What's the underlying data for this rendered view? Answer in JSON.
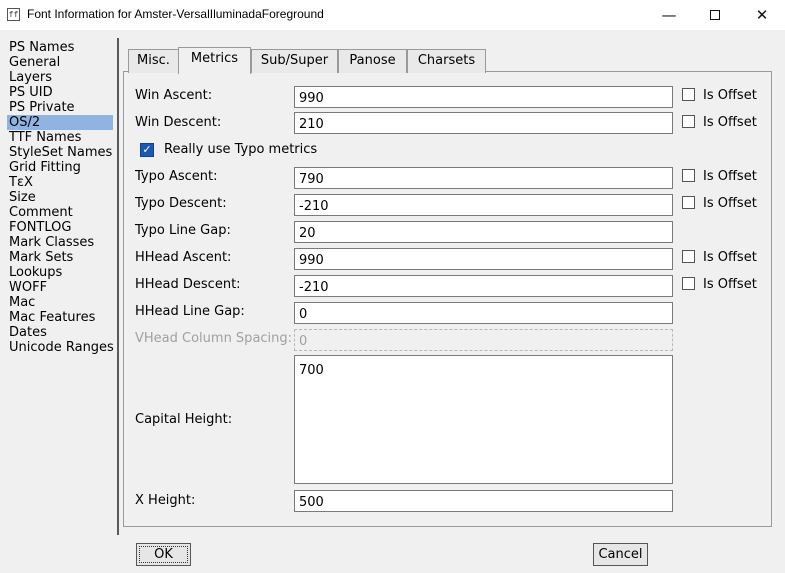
{
  "window": {
    "title": "Font Information for Amster-VersalIluminadaForeground",
    "icon": "fontforge-app-icon",
    "controls": {
      "minimize": "—",
      "close": "✕"
    }
  },
  "sidebar": {
    "items": [
      {
        "label": "PS Names"
      },
      {
        "label": "General"
      },
      {
        "label": "Layers"
      },
      {
        "label": "PS UID"
      },
      {
        "label": "PS Private"
      },
      {
        "label": "OS/2",
        "selected": true
      },
      {
        "label": "TTF Names"
      },
      {
        "label": "StyleSet Names"
      },
      {
        "label": "Grid Fitting"
      },
      {
        "label": "TεX"
      },
      {
        "label": "Size"
      },
      {
        "label": "Comment"
      },
      {
        "label": "FONTLOG"
      },
      {
        "label": "Mark Classes"
      },
      {
        "label": "Mark Sets"
      },
      {
        "label": "Lookups"
      },
      {
        "label": "WOFF"
      },
      {
        "label": "Mac"
      },
      {
        "label": "Mac Features"
      },
      {
        "label": "Dates"
      },
      {
        "label": "Unicode Ranges"
      }
    ],
    "selected_color": "#8fb4e2"
  },
  "tabs": [
    {
      "label": "Misc."
    },
    {
      "label": "Metrics",
      "active": true
    },
    {
      "label": "Sub/Super"
    },
    {
      "label": "Panose"
    },
    {
      "label": "Charsets"
    }
  ],
  "metrics": {
    "win_ascent": {
      "label": "Win Ascent:",
      "value": "990",
      "is_offset": false
    },
    "win_descent": {
      "label": "Win Descent:",
      "value": "210",
      "is_offset": false
    },
    "really_use_typo": {
      "label": "Really use Typo metrics",
      "checked": true
    },
    "typo_ascent": {
      "label": "Typo Ascent:",
      "value": "790",
      "is_offset": false
    },
    "typo_descent": {
      "label": "Typo Descent:",
      "value": "-210",
      "is_offset": false
    },
    "typo_line_gap": {
      "label": "Typo Line Gap:",
      "value": "20"
    },
    "hhead_ascent": {
      "label": "HHead Ascent:",
      "value": "990",
      "is_offset": false
    },
    "hhead_descent": {
      "label": "HHead Descent:",
      "value": "-210",
      "is_offset": false
    },
    "hhead_line_gap": {
      "label": "HHead Line Gap:",
      "value": "0"
    },
    "vhead_column_spacing": {
      "label": "VHead Column Spacing:",
      "value": "0",
      "disabled": true
    },
    "capital_height": {
      "label": "Capital Height:",
      "value": "700"
    },
    "x_height": {
      "label": "X Height:",
      "value": "500"
    },
    "is_offset_label": "Is Offset"
  },
  "buttons": {
    "ok": "OK",
    "cancel": "Cancel"
  }
}
